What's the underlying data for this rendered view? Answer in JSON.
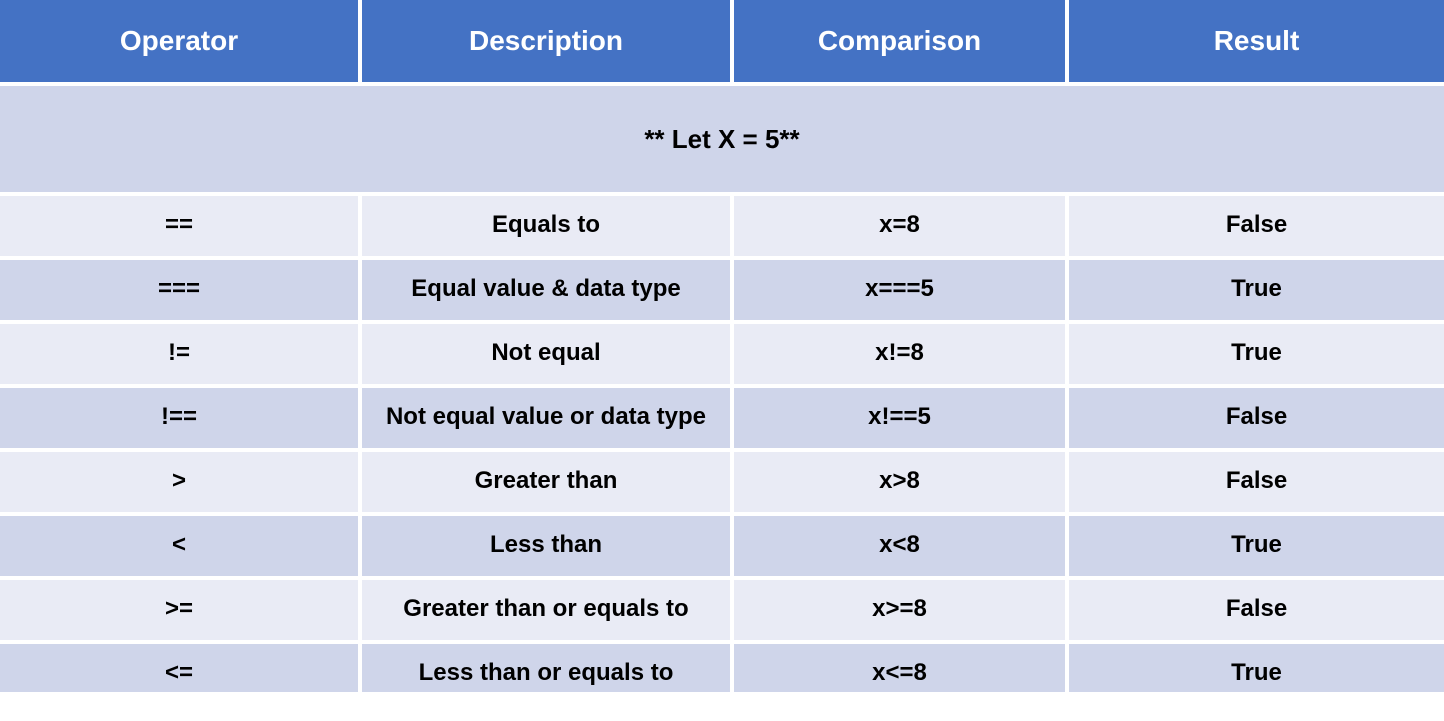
{
  "headers": {
    "operator": "Operator",
    "description": "Description",
    "comparison": "Comparison",
    "result": "Result"
  },
  "subheader": "** Let X = 5**",
  "rows": [
    {
      "operator": "==",
      "description": "Equals to",
      "comparison": "x=8",
      "result": "False"
    },
    {
      "operator": "===",
      "description": "Equal value & data type",
      "comparison": "x===5",
      "result": "True"
    },
    {
      "operator": "!=",
      "description": "Not equal",
      "comparison": "x!=8",
      "result": "True"
    },
    {
      "operator": "!==",
      "description": "Not equal value or data type",
      "comparison": "x!==5",
      "result": "False"
    },
    {
      "operator": ">",
      "description": "Greater than",
      "comparison": "x>8",
      "result": "False"
    },
    {
      "operator": "<",
      "description": "Less than",
      "comparison": "x<8",
      "result": "True"
    },
    {
      "operator": ">=",
      "description": "Greater than or equals to",
      "comparison": "x>=8",
      "result": "False"
    },
    {
      "operator": "<=",
      "description": "Less than or equals to",
      "comparison": "x<=8",
      "result": "True"
    }
  ],
  "chart_data": {
    "type": "table",
    "title": "Comparison Operators (Let X = 5)",
    "columns": [
      "Operator",
      "Description",
      "Comparison",
      "Result"
    ],
    "rows": [
      [
        "==",
        "Equals to",
        "x=8",
        "False"
      ],
      [
        "===",
        "Equal value & data type",
        "x===5",
        "True"
      ],
      [
        "!=",
        "Not equal",
        "x!=8",
        "True"
      ],
      [
        "!==",
        "Not equal value or data type",
        "x!==5",
        "False"
      ],
      [
        ">",
        "Greater than",
        "x>8",
        "False"
      ],
      [
        "<",
        "Less than",
        "x<8",
        "True"
      ],
      [
        ">=",
        "Greater than or equals to",
        "x>=8",
        "False"
      ],
      [
        "<=",
        "Less than or equals to",
        "x<=8",
        "True"
      ]
    ]
  }
}
